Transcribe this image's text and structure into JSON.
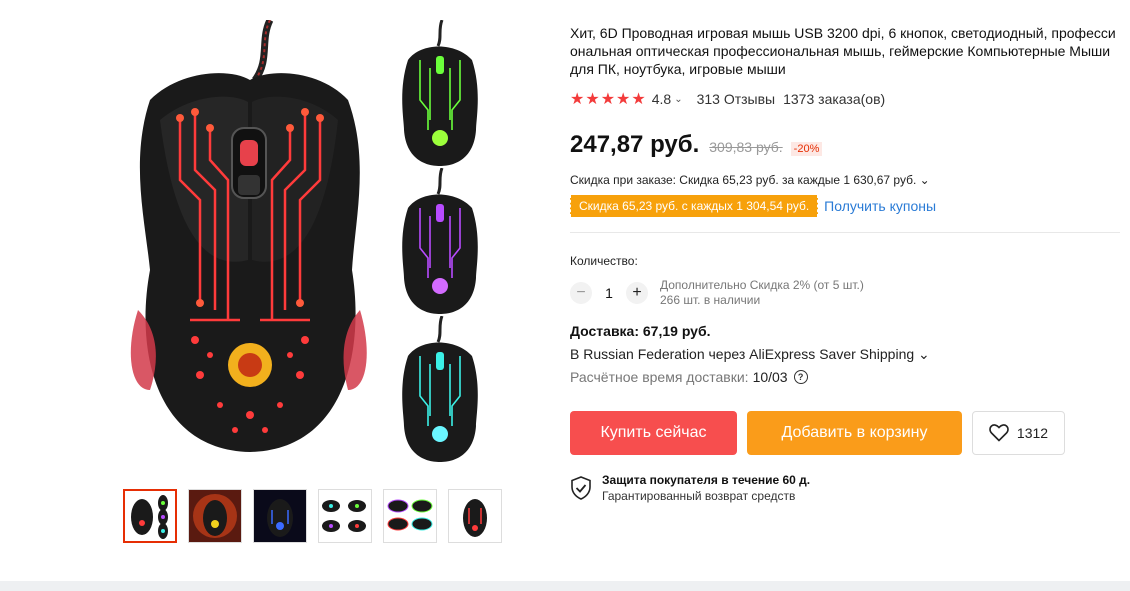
{
  "product": {
    "title": "Хит, 6D Проводная игровая мышь USB 3200 dpi, 6 кнопок, светодиодный, профессиональная оптическая профессиональная мышь, геймерские Компьютерные Мыши для ПК, ноутбука, игровые мыши",
    "rating": "4.8",
    "rating_stars": 5,
    "reviews": "313 Отзывы",
    "orders": "1373 заказа(ов)"
  },
  "price": {
    "current": "247,87 руб.",
    "old": "309,83 руб.",
    "discount": "-20%"
  },
  "order_discount": "Скидка при заказе: Скидка 65,23 руб. за каждые 1 630,67 руб. ⌄",
  "coupon": {
    "tag": "Скидка 65,23 руб. с каждых 1 304,54 руб.",
    "link": "Получить купоны"
  },
  "quantity": {
    "label": "Количество:",
    "value": "1",
    "note_line1": "Дополнительно Скидка 2% (от 5 шт.)",
    "note_line2": "266 шт. в наличии"
  },
  "delivery": {
    "title": "Доставка: 67,19 руб.",
    "route": "В Russian Federation через AliExpress Saver Shipping ⌄",
    "time_label": "Расчётное время доставки:",
    "time_value": "10/03"
  },
  "actions": {
    "buy": "Купить сейчас",
    "cart": "Добавить в корзину",
    "wishlist_count": "1312"
  },
  "protection": {
    "title": "Защита покупателя в течение 60 д.",
    "subtitle": "Гарантированный возврат средств"
  },
  "colors": {
    "accent_red": "#f74e4e",
    "accent_orange": "#fa9c1a",
    "coupon_orange": "#f7a10b",
    "link_blue": "#2a7bd6"
  },
  "gallery": {
    "side_variants": [
      "green",
      "purple",
      "cyan"
    ],
    "thumbnails": [
      "mouse-variants",
      "mouse-yellow-glow",
      "mouse-blue",
      "mice-row",
      "mice-colors",
      "mouse-red"
    ]
  }
}
